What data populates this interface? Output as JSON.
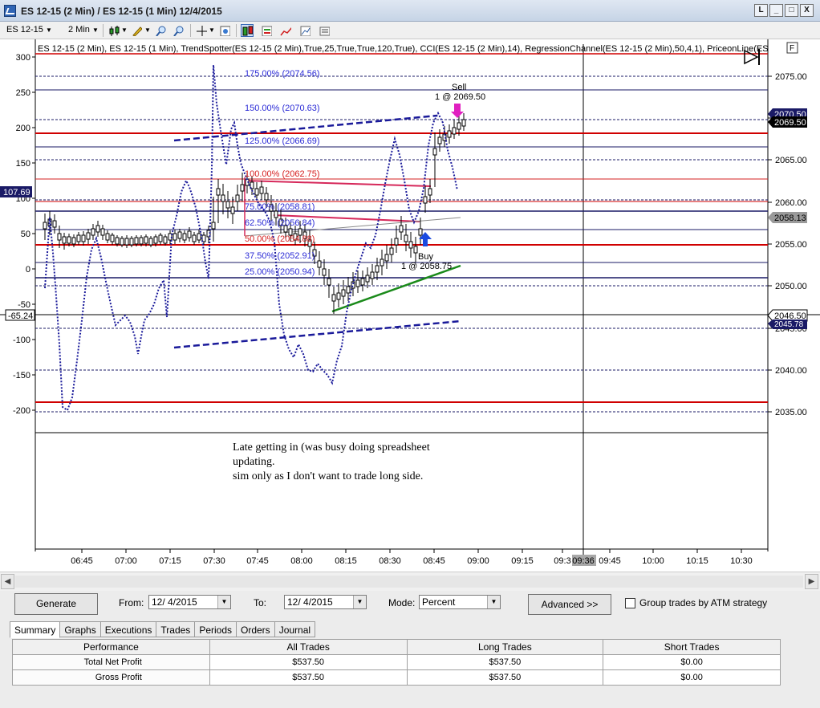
{
  "window": {
    "title": "ES 12-15 (2 Min) / ES 12-15 (1 Min)  12/4/2015",
    "buttons": [
      "L",
      "_",
      "□",
      "X"
    ]
  },
  "toolbar": {
    "instrument": "ES 12-15",
    "interval": "2 Min"
  },
  "chart": {
    "indicator_line": "ES 12-15 (2 Min), ES 12-15 (1 Min), TrendSpotter(ES 12-15 (2 Min),True,25,True,True,120,True), CCI(ES 12-15 (2 Min),14), RegressionChannel(ES 12-15 (2 Min),50,4,1), PriceonLine(ES",
    "panel_button": "F",
    "left_axis_ticks": [
      "300",
      "250",
      "200",
      "150",
      "100",
      "50",
      "0",
      "-50",
      "-100",
      "-150",
      "-200"
    ],
    "left_axis_badges": [
      "107.69",
      "-65.24"
    ],
    "right_axis_ticks": [
      "2075.00",
      "2070.00",
      "2065.00",
      "2060.00",
      "2055.00",
      "2050.00",
      "2045.00",
      "2040.00",
      "2035.00"
    ],
    "right_axis_badges": [
      "2070.50",
      "2069.50",
      "2058.13",
      "2046.50",
      "2045.78"
    ],
    "time_ticks": [
      "06:45",
      "07:00",
      "07:15",
      "07:30",
      "07:45",
      "08:00",
      "08:15",
      "08:30",
      "08:45",
      "09:00",
      "09:15",
      "09:3",
      "09:36",
      "09:45",
      "10:00",
      "10:15",
      "10:30"
    ],
    "fib_labels": [
      {
        "text": "175.00% (2074.56)",
        "color": "#2b2bd6"
      },
      {
        "text": "150.00% (2070.63)",
        "color": "#2b2bd6"
      },
      {
        "text": "125.00% (2066.69)",
        "color": "#2b2bd6"
      },
      {
        "text": "100.00% (2062.75)",
        "color": "#d62020"
      },
      {
        "text": "75.00% (2058.81)",
        "color": "#2b2bd6"
      },
      {
        "text": "62.50% (2056.84)",
        "color": "#2b2bd6"
      },
      {
        "text": "50.00% (2054.88)",
        "color": "#d62020"
      },
      {
        "text": "37.50% (2052.91)",
        "color": "#2b2bd6"
      },
      {
        "text": "25.00% (2050.94)",
        "color": "#2b2bd6"
      }
    ],
    "trades": {
      "sell_label": "Sell",
      "sell_detail": "1 @ 2069.50",
      "buy_label": "Buy",
      "buy_detail": "1 @ 2058.75"
    },
    "note_lines": [
      "Late getting in (was busy doing spreadsheet",
      "updating.",
      "sim only as I don't want to trade long side."
    ],
    "colors": {
      "cci": "#1a1a9a",
      "support": "#d00000",
      "fib_blue": "#2b2bd6",
      "fib_red": "#d62020",
      "uptrend": "#1a8a1a",
      "trade_line": "#d6285a",
      "axis_badge": "#1a1a66"
    }
  },
  "performance": {
    "generate_label": "Generate",
    "from_label": "From:",
    "from_value": "12/ 4/2015",
    "to_label": "To:",
    "to_value": "12/ 4/2015",
    "mode_label": "Mode:",
    "mode_value": "Percent",
    "advanced_label": "Advanced >>",
    "group_label": "Group trades by ATM strategy",
    "tabs": [
      "Summary",
      "Graphs",
      "Executions",
      "Trades",
      "Periods",
      "Orders",
      "Journal"
    ],
    "columns": [
      "Performance",
      "All Trades",
      "Long Trades",
      "Short Trades"
    ],
    "rows": [
      [
        "Total Net Profit",
        "$537.50",
        "$537.50",
        "$0.00"
      ],
      [
        "Gross Profit",
        "$537.50",
        "$537.50",
        "$0.00"
      ]
    ]
  }
}
